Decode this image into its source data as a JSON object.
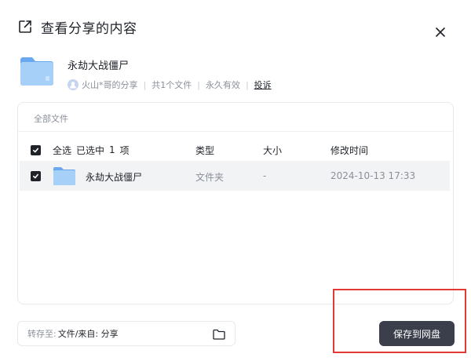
{
  "header": {
    "title": "查看分享的内容"
  },
  "share": {
    "name": "永劫大战僵尸",
    "sharer": "火山*哥的分享",
    "file_count": "共1个文件",
    "validity": "永久有效",
    "report_label": "投诉"
  },
  "files": {
    "breadcrumb": "全部文件",
    "header": {
      "select_all": "全选",
      "selected_prefix": "已选中",
      "selected_count": "1",
      "selected_suffix": "项",
      "type": "类型",
      "size": "大小",
      "modified": "修改时间"
    },
    "rows": [
      {
        "name": "永劫大战僵尸",
        "type": "文件夹",
        "size": "-",
        "modified": "2024-10-13 17:33",
        "checked": true
      }
    ]
  },
  "footer": {
    "dest_label": "转存至:",
    "dest_value": "文件/来自: 分享",
    "save_label": "保存到网盘"
  },
  "colors": {
    "primary_button": "#3a3f4b",
    "folder": "#7cb6f2",
    "highlight": "#e53935"
  },
  "icons": [
    "share-external-icon",
    "close-icon",
    "folder-icon",
    "avatar-icon",
    "checkbox-checked-icon",
    "folder-outline-icon"
  ]
}
